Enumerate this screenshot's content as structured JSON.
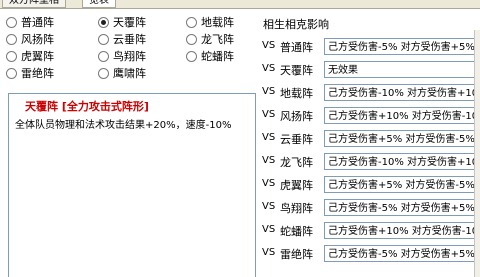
{
  "tabs": [
    {
      "label": "双方阵型相",
      "active": false
    },
    {
      "label": "览表",
      "active": true
    }
  ],
  "formations": {
    "items": [
      {
        "label": "普通阵",
        "checked": false
      },
      {
        "label": "天覆阵",
        "checked": true
      },
      {
        "label": "地载阵",
        "checked": false
      },
      {
        "label": "风扬阵",
        "checked": false
      },
      {
        "label": "云垂阵",
        "checked": false
      },
      {
        "label": "龙飞阵",
        "checked": false
      },
      {
        "label": "虎翼阵",
        "checked": false
      },
      {
        "label": "鸟翔阵",
        "checked": false
      },
      {
        "label": "蛇蟠阵",
        "checked": false
      },
      {
        "label": "雷绝阵",
        "checked": false
      },
      {
        "label": "鹰啸阵",
        "checked": false
      }
    ]
  },
  "description": {
    "title": "天覆阵 [全力攻击式阵形]",
    "text": "全体队员物理和法术攻击结果+20%，速度-10%"
  },
  "relations": {
    "title": "相生相克影响",
    "vs_label": "VS",
    "rows": [
      {
        "name": "普通阵",
        "effect": "己方受伤害-5% 对方受伤害+5%"
      },
      {
        "name": "天覆阵",
        "effect": "无效果"
      },
      {
        "name": "地载阵",
        "effect": "己方受伤害-10% 对方受伤害+10%"
      },
      {
        "name": "风扬阵",
        "effect": "己方受伤害+10% 对方受伤害-10%"
      },
      {
        "name": "云垂阵",
        "effect": "己方受伤害+5% 对方受伤害-5%"
      },
      {
        "name": "龙飞阵",
        "effect": "己方受伤害-10% 对方受伤害+10%"
      },
      {
        "name": "虎翼阵",
        "effect": "己方受伤害+5% 对方受伤害-5%"
      },
      {
        "name": "鸟翔阵",
        "effect": "己方受伤害-5% 对方受伤害+5%"
      },
      {
        "name": "蛇蟠阵",
        "effect": "己方受伤害+10% 对方受伤害-10%"
      },
      {
        "name": "雷绝阵",
        "effect": "己方受伤害-5% 对方受伤害+5%"
      }
    ]
  }
}
